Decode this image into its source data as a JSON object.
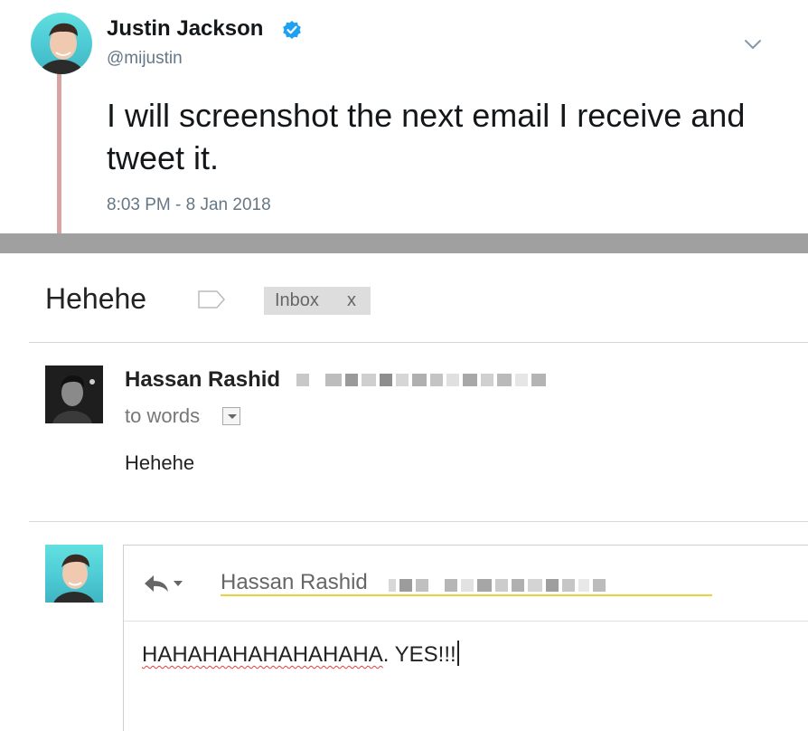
{
  "tweet": {
    "author_name": "Justin Jackson",
    "handle": "@mijustin",
    "text": "I will screenshot the next email I receive and tweet it.",
    "timestamp": "8:03 PM - 8 Jan 2018",
    "verified_icon": "verified-badge-icon",
    "menu_icon": "chevron-down-icon"
  },
  "email": {
    "subject": "Hehehe",
    "label_chip": "Inbox",
    "label_remove": "x",
    "sender_name": "Hassan Rashid",
    "to_line": "to words",
    "body": "Hehehe"
  },
  "reply": {
    "recipient": "Hassan Rashid",
    "draft_misspelled": "HAHAHAHAHAHAHAHA",
    "draft_rest": ". YES!!!"
  },
  "colors": {
    "thread_line": "#d8a3a3",
    "divider_band": "#a0a0a0",
    "verified_blue": "#1da1f2",
    "recipient_underline": "#e8d23c",
    "spellcheck": "#e04040"
  }
}
